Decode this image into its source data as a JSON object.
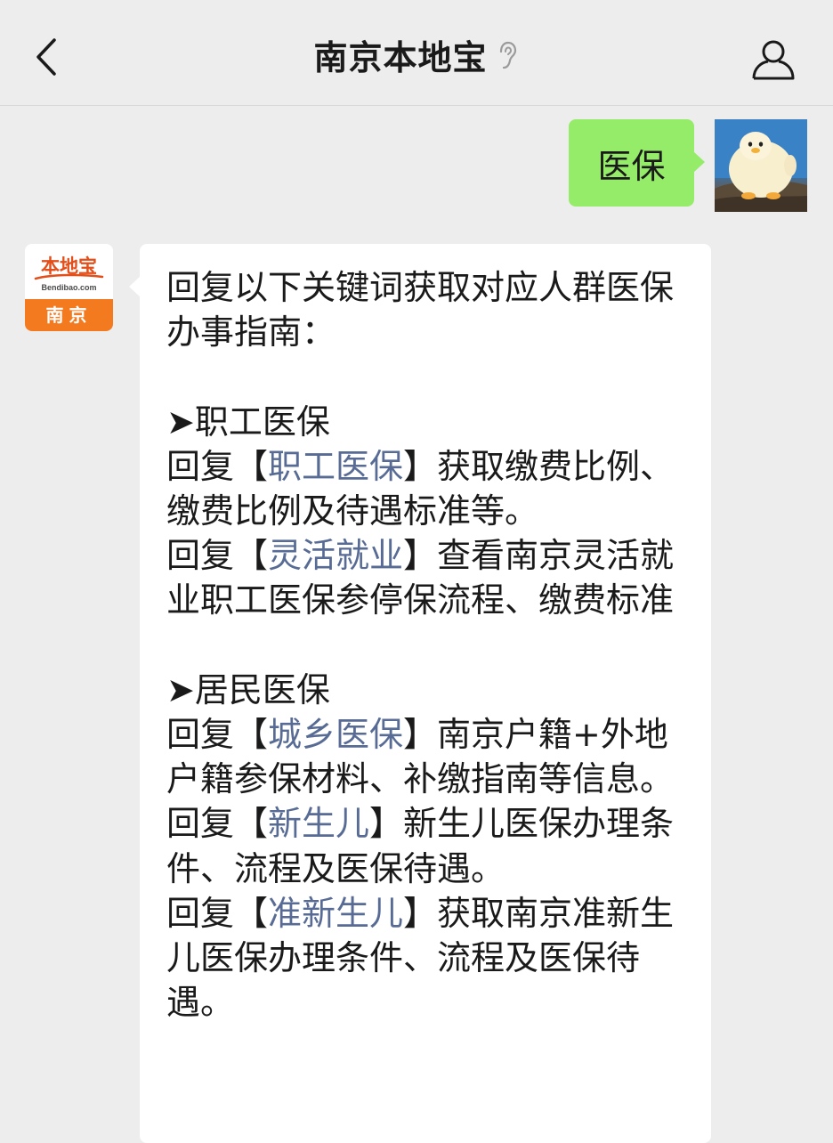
{
  "header": {
    "title": "南京本地宝",
    "back_icon": "chevron-left-icon",
    "ear_icon": "ear-icon",
    "profile_icon": "person-icon"
  },
  "user_message": {
    "text": "医保"
  },
  "bot": {
    "avatar": {
      "brand": "本地宝",
      "domain": "Bendibao.com",
      "city": "南京"
    },
    "intro": "回复以下关键词获取对应人群医保办事指南：",
    "sections": [
      {
        "heading": "➤职工医保",
        "items": [
          {
            "prefix": "回复【",
            "keyword": "职工医保",
            "suffix": "】获取缴费比例、缴费比例及待遇标准等。"
          },
          {
            "prefix": "回复【",
            "keyword": "灵活就业",
            "suffix": "】查看南京灵活就业职工医保参停保流程、缴费标准"
          }
        ]
      },
      {
        "heading": "➤居民医保",
        "items": [
          {
            "prefix": "回复【",
            "keyword": "城乡医保",
            "suffix": "】南京户籍+外地户籍参保材料、补缴指南等信息。"
          },
          {
            "prefix": "回复【",
            "keyword": "新生儿",
            "suffix": "】新生儿医保办理条件、流程及医保待遇。"
          },
          {
            "prefix": "回复【",
            "keyword": "准新生儿",
            "suffix": "】获取南京准新生儿医保办理条件、流程及医保待遇。"
          }
        ]
      }
    ]
  },
  "colors": {
    "background": "#ededed",
    "user_bubble": "#95ec69",
    "link": "#576b95",
    "brand_orange": "#f37a1f"
  }
}
